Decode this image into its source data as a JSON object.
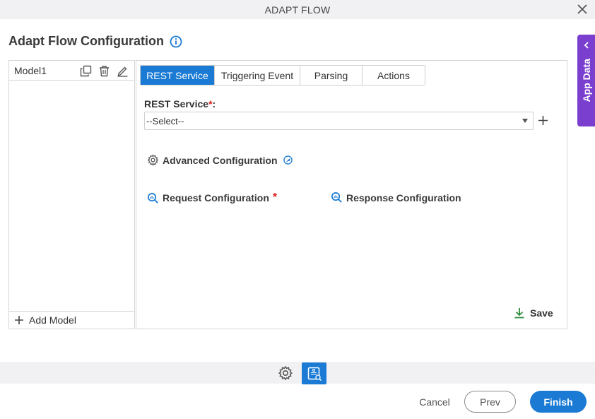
{
  "window": {
    "title": "ADAPT FLOW"
  },
  "page": {
    "title": "Adapt Flow Configuration"
  },
  "app_data": {
    "label": "App Data"
  },
  "models": {
    "items": [
      {
        "name": "Model1"
      }
    ],
    "add_label": "Add Model"
  },
  "tabs": [
    {
      "label": "REST Service",
      "active": true
    },
    {
      "label": "Triggering Event",
      "active": false
    },
    {
      "label": "Parsing",
      "active": false
    },
    {
      "label": "Actions",
      "active": false
    }
  ],
  "rest_service": {
    "label": "REST Service",
    "required_mark": "*",
    "colon": ":",
    "value": "--Select--"
  },
  "advanced_config": {
    "label": "Advanced Configuration"
  },
  "request_config": {
    "label": "Request Configuration",
    "required_mark": "*"
  },
  "response_config": {
    "label": "Response Configuration"
  },
  "save": {
    "label": "Save"
  },
  "footer": {
    "cancel_label": "Cancel",
    "prev_label": "Prev",
    "finish_label": "Finish"
  },
  "colors": {
    "primary": "#1a7ad4",
    "app_data": "#7b3fd0",
    "required": "#d9231d",
    "save_icon": "#2e8b3d"
  }
}
